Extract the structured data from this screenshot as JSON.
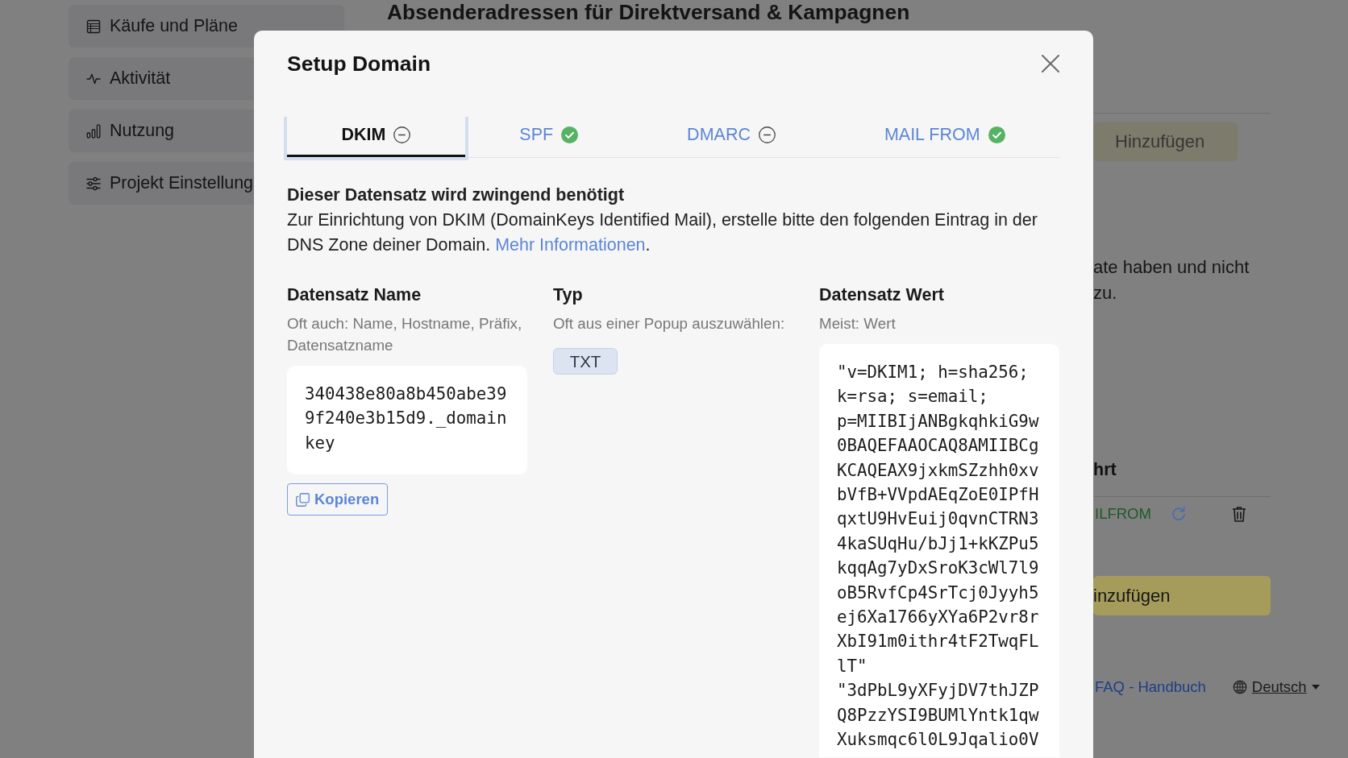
{
  "page": {
    "sidebar": [
      {
        "label": "Käufe und Pläne",
        "selected": false
      },
      {
        "label": "Aktivität",
        "selected": false
      },
      {
        "label": "Nutzung",
        "selected": false
      },
      {
        "label": "Projekt Einstellung",
        "selected": false
      }
    ],
    "heading": "Absenderadressen für Direktversand & Kampagnen",
    "add_button": "Hinzufügen",
    "note_lines": [
      "ate haben und nicht",
      "zu."
    ],
    "section_heading": "hrt",
    "record_row": {
      "label": "ILFROM"
    },
    "add_button_2": "inzufügen",
    "footer": {
      "help_link": "FAQ - Handbuch",
      "language": "Deutsch"
    }
  },
  "dialog": {
    "title": "Setup Domain",
    "tabs": [
      {
        "label": "DKIM",
        "selected": true,
        "verified": false
      },
      {
        "label": "SPF",
        "selected": false,
        "verified": true
      },
      {
        "label": "DMARC",
        "selected": false,
        "verified": false
      },
      {
        "label": "MAIL FROM",
        "selected": false,
        "verified": true
      }
    ],
    "requirement": "Dieser Datensatz wird zwingend benötigt",
    "description": "Zur Einrichtung von DKIM (DomainKeys Identified Mail), erstelle bitte den folgenden Eintrag in der DNS Zone deiner Domain.",
    "more_link": "Mehr Informationen",
    "description_end": ".",
    "columns": [
      {
        "kind": "code",
        "heading": "Datensatz Name",
        "hint": "Oft auch: Name, Hostname, Präfix, Datensatzname",
        "value": "340438e80a8b450abe399f240e3b15d9._domainkey",
        "copy_button": "Kopieren"
      },
      {
        "kind": "tag",
        "heading": "Typ",
        "hint": "Oft aus einer Popup auszuwählen:",
        "value": "TXT"
      },
      {
        "kind": "code",
        "heading": "Datensatz Wert",
        "hint": "Meist: Wert",
        "value": "\"v=DKIM1; h=sha256; k=rsa; s=email; p=MIIBIjANBgkqhkiG9w0BAQEFAAOCAQ8AMIIBCgKCAQEAX9jxkmSZzhh0xvbVfB+VVpdAEqZoE0IPfHqxtU9HvEuij0qvnCTRN34kaSUqHu/bJj1+kKZPu5kqqAg7yDxSroK3cWl7l9oB5RvfCp4SrTcj0Jyyh5ej6Xa1766yXYa6P2vr8rXbI91m0ithr4tF2TwqFLlT\" \"3dPbL9yXFyjDV7thJZPQ8PzzYSI9BUMlYntk1qwXuksmqc6l0L9Jqalio0V"
      }
    ]
  }
}
